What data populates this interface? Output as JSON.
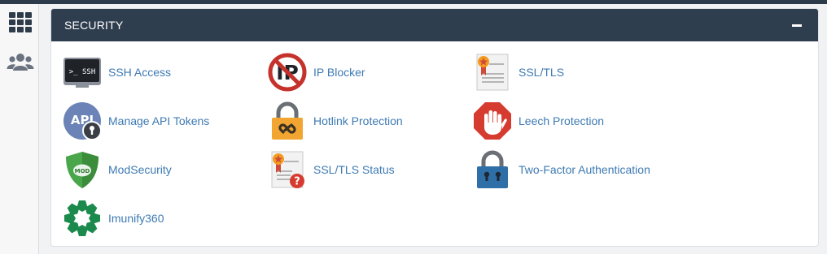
{
  "section": {
    "title": "SECURITY",
    "items": [
      {
        "label": "SSH Access",
        "icon": "ssh-terminal-icon"
      },
      {
        "label": "IP Blocker",
        "icon": "ip-blocker-icon"
      },
      {
        "label": "SSL/TLS",
        "icon": "certificate-icon"
      },
      {
        "label": "Manage API Tokens",
        "icon": "api-tokens-icon"
      },
      {
        "label": "Hotlink Protection",
        "icon": "hotlink-lock-icon"
      },
      {
        "label": "Leech Protection",
        "icon": "leech-hand-icon"
      },
      {
        "label": "ModSecurity",
        "icon": "mod-shield-icon"
      },
      {
        "label": "SSL/TLS Status",
        "icon": "certificate-status-icon"
      },
      {
        "label": "Two-Factor Authentication",
        "icon": "two-factor-lock-icon"
      },
      {
        "label": "Imunify360",
        "icon": "imunify360-icon"
      }
    ]
  },
  "sidebar": {
    "items": [
      {
        "icon": "grid-icon"
      },
      {
        "icon": "users-icon"
      }
    ]
  },
  "colors": {
    "header_bg": "#2f3e4f",
    "link": "#3e7ab3",
    "sidebar_icon": "#2d3b4a"
  }
}
